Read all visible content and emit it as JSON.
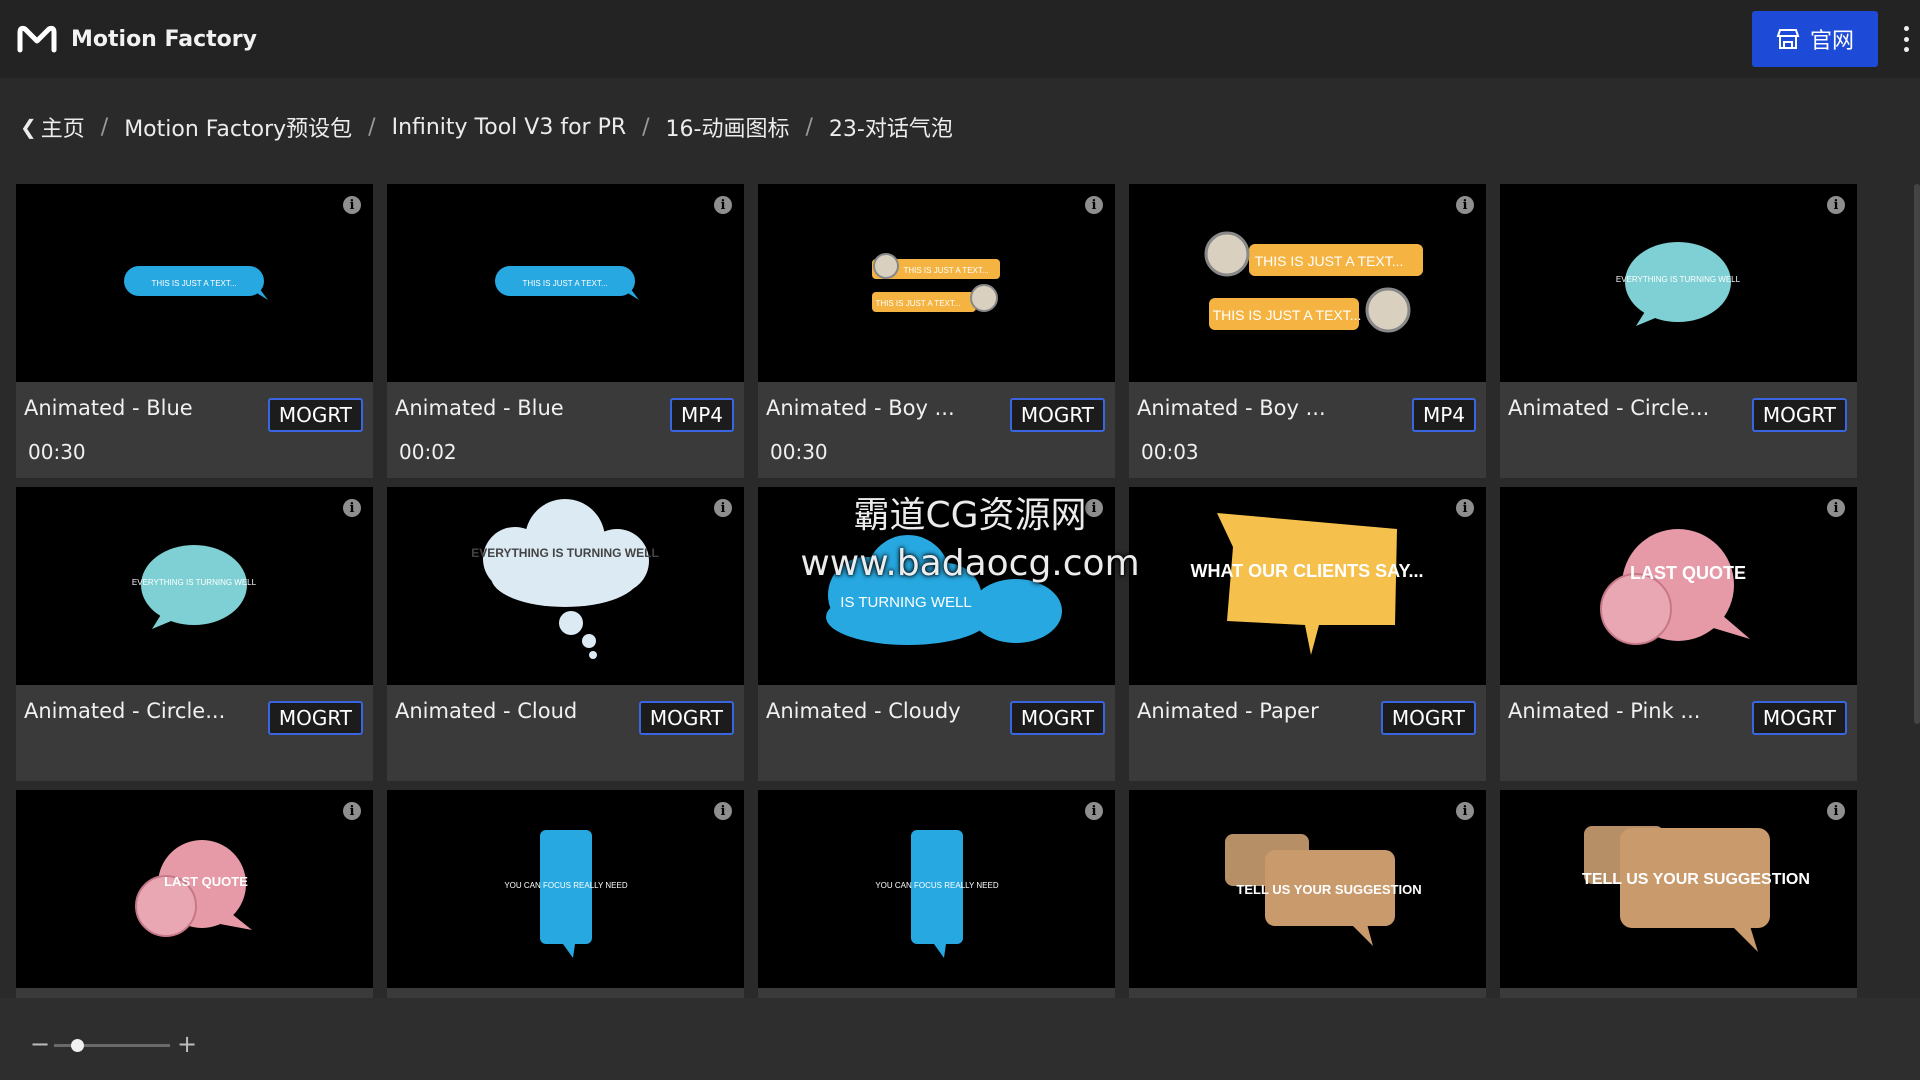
{
  "app": {
    "title": "Motion Factory",
    "site_button": "官网"
  },
  "breadcrumb": [
    "主页",
    "Motion Factory预设包",
    "Infinity Tool V3 for PR",
    "16-动画图标",
    "23-对话气泡"
  ],
  "watermark": {
    "line1": "霸道CG资源网",
    "line2": "www.badaocg.com"
  },
  "cards": [
    {
      "name": "Animated - Blue",
      "format": "MOGRT",
      "duration": "00:30",
      "thumb_text": "THIS IS JUST A TEXT..."
    },
    {
      "name": "Animated - Blue",
      "format": "MP4",
      "duration": "00:02",
      "thumb_text": "THIS IS JUST A TEXT..."
    },
    {
      "name": "Animated - Boy ...",
      "format": "MOGRT",
      "duration": "00:30",
      "thumb_text": "THIS IS JUST A TEXT..."
    },
    {
      "name": "Animated - Boy ...",
      "format": "MP4",
      "duration": "00:03",
      "thumb_text": "THIS IS JUST A TEXT..."
    },
    {
      "name": "Animated - Circle...",
      "format": "MOGRT",
      "duration": "",
      "thumb_text": "EVERYTHING IS TURNING WELL"
    },
    {
      "name": "Animated - Circle...",
      "format": "MOGRT",
      "duration": "",
      "thumb_text": "EVERYTHING IS TURNING WELL"
    },
    {
      "name": "Animated - Cloud",
      "format": "MOGRT",
      "duration": "",
      "thumb_text": "EVERYTHING IS TURNING WELL"
    },
    {
      "name": "Animated - Cloudy",
      "format": "MOGRT",
      "duration": "",
      "thumb_text": "IS TURNING WELL"
    },
    {
      "name": "Animated - Paper",
      "format": "MOGRT",
      "duration": "",
      "thumb_text": "WHAT OUR CLIENTS SAY..."
    },
    {
      "name": "Animated - Pink ...",
      "format": "MOGRT",
      "duration": "",
      "thumb_text": "LAST QUOTE"
    },
    {
      "name": "",
      "format": "",
      "duration": "",
      "thumb_text": "LAST QUOTE"
    },
    {
      "name": "",
      "format": "",
      "duration": "",
      "thumb_text": "YOU CAN FOCUS REALLY NEED"
    },
    {
      "name": "",
      "format": "",
      "duration": "",
      "thumb_text": "YOU CAN FOCUS REALLY NEED"
    },
    {
      "name": "",
      "format": "",
      "duration": "",
      "thumb_text": "TELL US YOUR SUGGESTION"
    },
    {
      "name": "",
      "format": "",
      "duration": "",
      "thumb_text": "TELL US YOUR SUGGESTION"
    }
  ],
  "zoom": {
    "level": 0.2,
    "minus": "−",
    "plus": "+"
  },
  "colors": {
    "accent": "#1d4bd8",
    "badge_border": "#3a65e0",
    "bubble_blue": "#27a8e0",
    "bubble_orange": "#f5b441",
    "bubble_teal": "#7fd0d4",
    "bubble_pink": "#e69aa8",
    "bubble_tan": "#c99a6c"
  }
}
